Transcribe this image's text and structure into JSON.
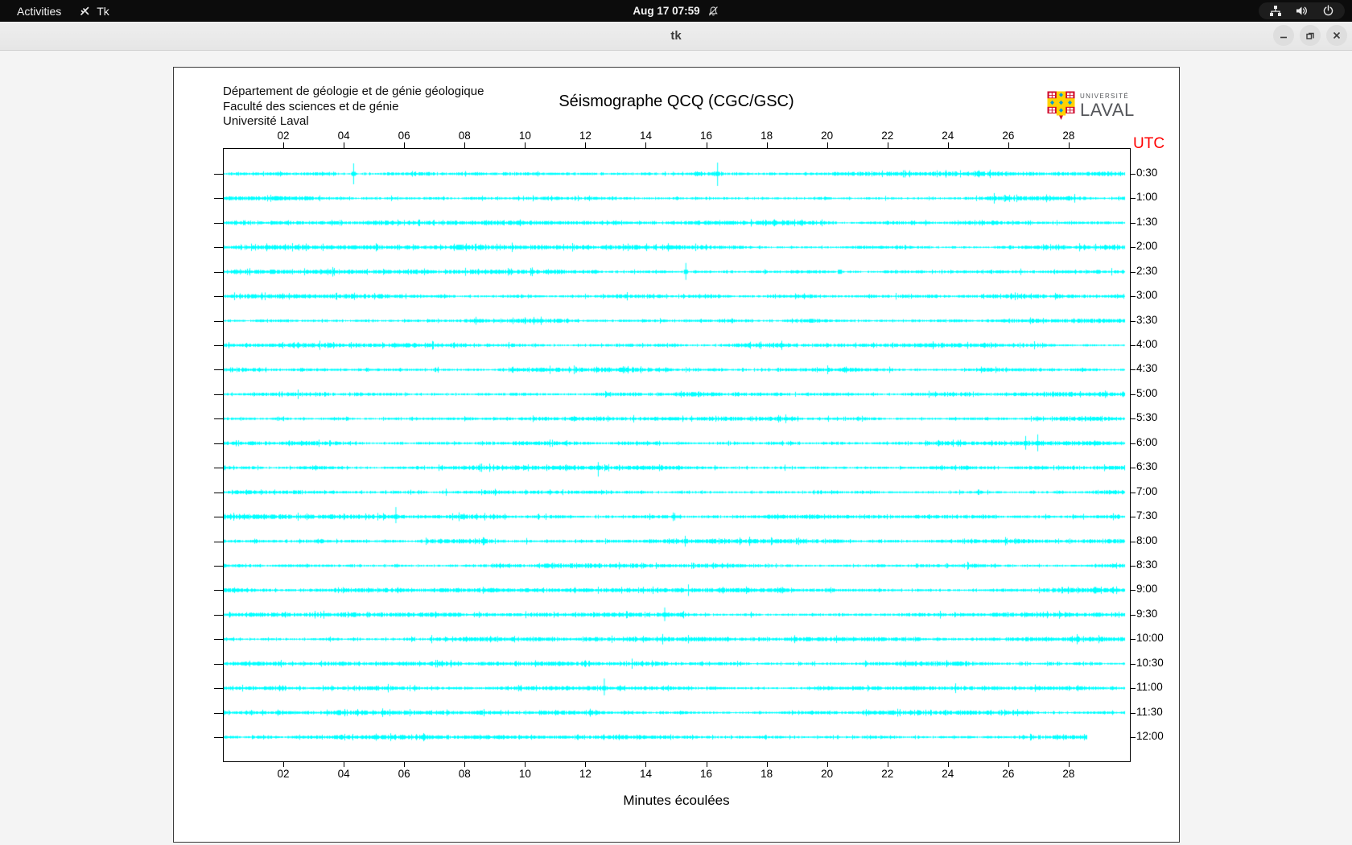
{
  "topbar": {
    "activities_label": "Activities",
    "app_name": "Tk",
    "clock": "Aug 17  07:59",
    "tray_icons": [
      "network-icon",
      "volume-icon",
      "power-icon"
    ]
  },
  "titlebar": {
    "title": "tk",
    "buttons": [
      "minimize",
      "maximize",
      "close"
    ]
  },
  "window": {
    "header_lines": [
      "Département de géologie et de génie géologique",
      "Faculté des sciences et de génie",
      "Université Laval"
    ],
    "logo": {
      "line1": "UNIVERSITÉ",
      "line2": "LAVAL"
    }
  },
  "chart_data": {
    "type": "line",
    "title": "Séismographe QCQ (CGC/GSC)",
    "xlabel": "Minutes écoulées",
    "right_axis_label": "UTC",
    "right_axis_color": "#ff0000",
    "trace_color": "#00ffff",
    "x_ticks": [
      "02",
      "04",
      "06",
      "08",
      "10",
      "12",
      "14",
      "16",
      "18",
      "20",
      "22",
      "24",
      "26",
      "28"
    ],
    "x_range_minutes": [
      0,
      30
    ],
    "rows": [
      {
        "label": "0:30",
        "spikes": [
          {
            "m": 4.3,
            "up": 13,
            "down": 13
          },
          {
            "m": 16.35,
            "up": 14,
            "down": 15
          }
        ]
      },
      {
        "label": "1:00",
        "spikes": []
      },
      {
        "label": "1:30",
        "spikes": []
      },
      {
        "label": "2:00",
        "spikes": [
          {
            "m": 7.8,
            "up": 3,
            "down": 3,
            "w": 8
          }
        ]
      },
      {
        "label": "2:30",
        "spikes": [
          {
            "m": 1.6,
            "up": 2,
            "down": 2,
            "w": 6
          },
          {
            "m": 15.3,
            "up": 11,
            "down": 10
          },
          {
            "m": 20.4,
            "up": 2,
            "down": 2,
            "w": 5
          }
        ]
      },
      {
        "label": "3:00",
        "spikes": []
      },
      {
        "label": "3:30",
        "spikes": []
      },
      {
        "label": "4:00",
        "spikes": []
      },
      {
        "label": "4:30",
        "spikes": []
      },
      {
        "label": "5:00",
        "spikes": []
      },
      {
        "label": "5:30",
        "spikes": []
      },
      {
        "label": "6:00",
        "spikes": [
          {
            "m": 26.55,
            "up": 9,
            "down": 8
          },
          {
            "m": 26.95,
            "up": 11,
            "down": 10
          }
        ]
      },
      {
        "label": "6:30",
        "spikes": [
          {
            "m": 12.4,
            "up": 7,
            "down": 11
          }
        ]
      },
      {
        "label": "7:00",
        "spikes": []
      },
      {
        "label": "7:30",
        "spikes": [
          {
            "m": 5.7,
            "up": 12,
            "down": 8
          }
        ]
      },
      {
        "label": "8:00",
        "spikes": []
      },
      {
        "label": "8:30",
        "spikes": []
      },
      {
        "label": "9:00",
        "spikes": [
          {
            "m": 28.85,
            "up": 4,
            "down": 4,
            "w": 3
          }
        ]
      },
      {
        "label": "9:30",
        "spikes": [
          {
            "m": 14.6,
            "up": 9,
            "down": 8
          }
        ]
      },
      {
        "label": "10:00",
        "spikes": []
      },
      {
        "label": "10:30",
        "spikes": []
      },
      {
        "label": "11:00",
        "spikes": [
          {
            "m": 12.6,
            "up": 12,
            "down": 9
          }
        ]
      },
      {
        "label": "11:30",
        "spikes": []
      },
      {
        "label": "12:00",
        "spikes": [],
        "end_minute": 28.6
      }
    ]
  }
}
